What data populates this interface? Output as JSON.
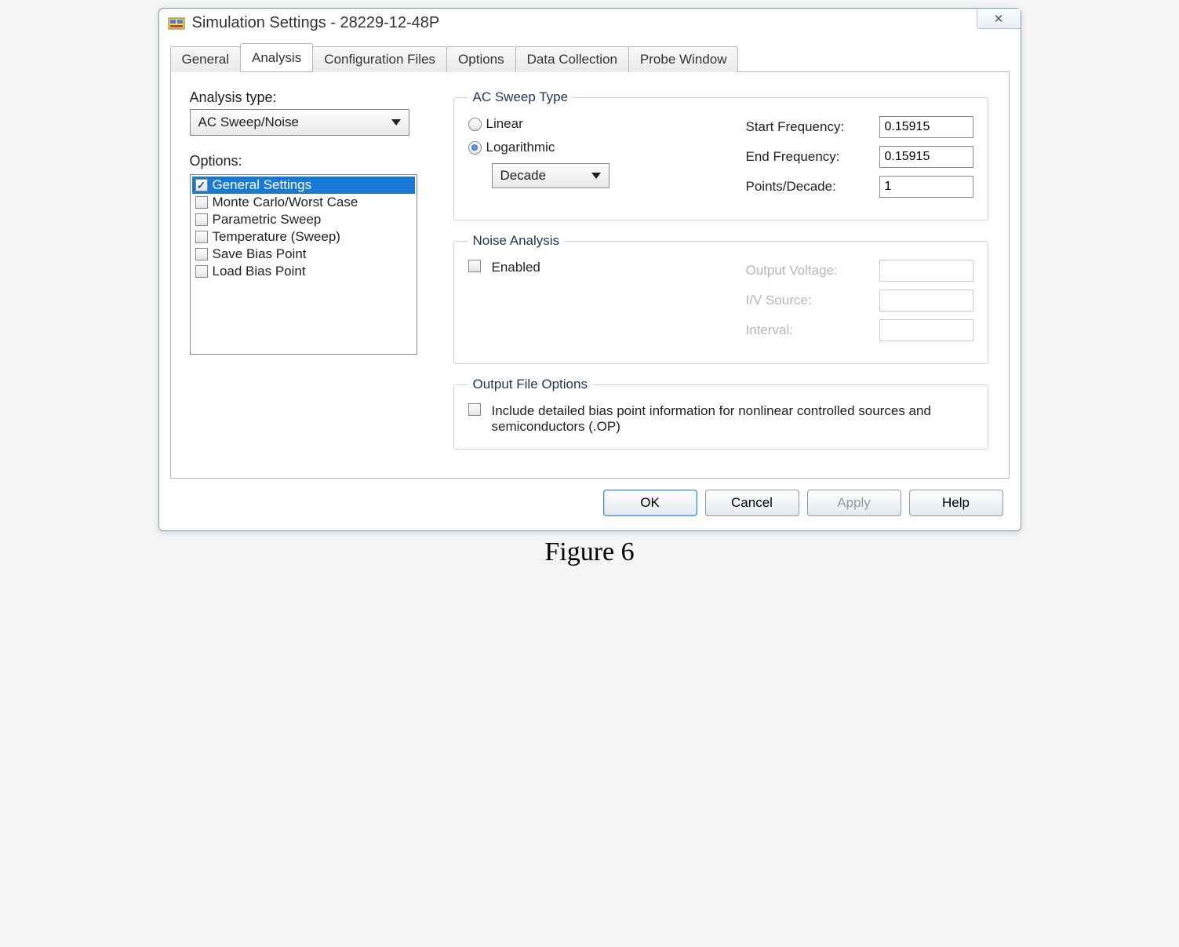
{
  "window": {
    "title": "Simulation Settings - 28229-12-48P"
  },
  "tabs": [
    "General",
    "Analysis",
    "Configuration Files",
    "Options",
    "Data Collection",
    "Probe Window"
  ],
  "active_tab": 1,
  "analysis": {
    "type_label": "Analysis type:",
    "type_value": "AC Sweep/Noise",
    "options_label": "Options:",
    "options": [
      {
        "label": "General Settings",
        "checked": true,
        "selected": true
      },
      {
        "label": "Monte Carlo/Worst Case",
        "checked": false
      },
      {
        "label": "Parametric Sweep",
        "checked": false
      },
      {
        "label": "Temperature (Sweep)",
        "checked": false
      },
      {
        "label": "Save Bias Point",
        "checked": false
      },
      {
        "label": "Load Bias Point",
        "checked": false
      }
    ]
  },
  "ac_sweep": {
    "legend": "AC Sweep Type",
    "linear_label": "Linear",
    "log_label": "Logarithmic",
    "selected": "log",
    "scale_value": "Decade",
    "start_label": "Start Frequency:",
    "start_value": "0.15915",
    "end_label": "End Frequency:",
    "end_value": "0.15915",
    "points_label": "Points/Decade:",
    "points_value": "1"
  },
  "noise": {
    "legend": "Noise Analysis",
    "enabled_label": "Enabled",
    "enabled": false,
    "output_label": "Output Voltage:",
    "iv_label": "I/V Source:",
    "interval_label": "Interval:",
    "output_value": "",
    "iv_value": "",
    "interval_value": ""
  },
  "output_file": {
    "legend": "Output File Options",
    "include_op_label": "Include detailed bias point information for nonlinear controlled sources and semiconductors (.OP)",
    "include_op": false
  },
  "buttons": {
    "ok": "OK",
    "cancel": "Cancel",
    "apply": "Apply",
    "help": "Help"
  },
  "figure_caption": "Figure 6"
}
